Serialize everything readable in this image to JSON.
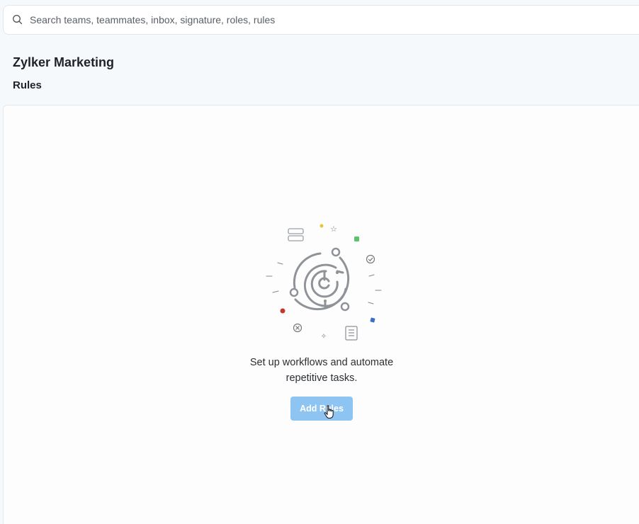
{
  "search": {
    "placeholder": "Search teams, teammates, inbox, signature, roles, rules",
    "icon": "search-icon"
  },
  "header": {
    "team_name": "Zylker Marketing",
    "section": "Rules"
  },
  "empty_state": {
    "line1": "Set up workflows and automate",
    "line2": "repetitive tasks.",
    "button_label": "Add Rules",
    "illustration": "workflow-maze-illustration"
  },
  "colors": {
    "button": "#8ec4f2",
    "accent_yellow": "#e7c33a",
    "accent_green": "#5cc26b",
    "accent_red": "#c0392b",
    "accent_blue": "#3a6fc9"
  }
}
